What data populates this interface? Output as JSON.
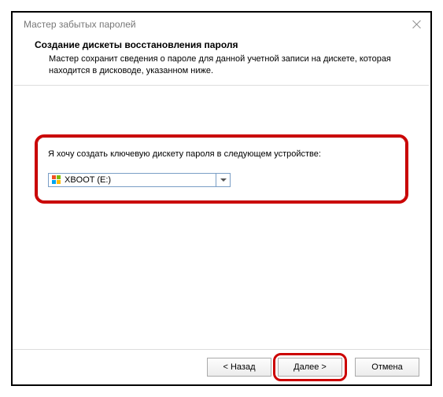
{
  "window": {
    "title": "Мастер забытых паролей"
  },
  "header": {
    "heading": "Создание дискеты восстановления пароля",
    "sub": "Мастер сохранит сведения о пароле для данной учетной записи на дискете, которая находится в дисководе, указанном ниже."
  },
  "content": {
    "prompt": "Я хочу создать ключевую дискету пароля в следующем устройстве:",
    "drive_selected": "XBOOT (E:)"
  },
  "buttons": {
    "back": "< Назад",
    "next": "Далее >",
    "cancel": "Отмена"
  }
}
